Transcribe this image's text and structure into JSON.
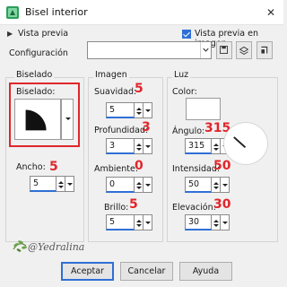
{
  "window": {
    "title": "Bisel interior",
    "close_glyph": "✕"
  },
  "preview": {
    "label": "Vista previa",
    "preview_in_image_label": "Vista previa en imagen",
    "preview_in_image_checked": true
  },
  "config": {
    "label": "Configuración",
    "value": ""
  },
  "groups": {
    "biselado": "Biselado",
    "imagen": "Imagen",
    "luz": "Luz"
  },
  "biselado": {
    "label": "Biselado:",
    "ancho": {
      "label": "Ancho:",
      "value": "5",
      "annotation": "5"
    }
  },
  "imagen": {
    "suavidad": {
      "label": "Suavidad:",
      "value": "5",
      "annotation": "5"
    },
    "profundidad": {
      "label": "Profundidad:",
      "value": "3",
      "annotation": "3"
    },
    "ambiente": {
      "label": "Ambiente:",
      "value": "0",
      "annotation": "0"
    },
    "brillo": {
      "label": "Brillo:",
      "value": "5",
      "annotation": "5"
    }
  },
  "luz": {
    "color": {
      "label": "Color:",
      "value": "#ffffff"
    },
    "angulo": {
      "label": "Ángulo:",
      "value": "315",
      "annotation": "315"
    },
    "intensidad": {
      "label": "Intensidad:",
      "value": "50",
      "annotation": "50"
    },
    "elevacion": {
      "label": "Elevación:",
      "value": "30",
      "annotation": "30"
    }
  },
  "buttons": {
    "ok": "Aceptar",
    "cancel": "Cancelar",
    "help": "Ayuda"
  },
  "watermark": {
    "text": "@Yedralina"
  },
  "colors": {
    "accent": "#2f6fd6",
    "annotation": "#e0262b"
  }
}
